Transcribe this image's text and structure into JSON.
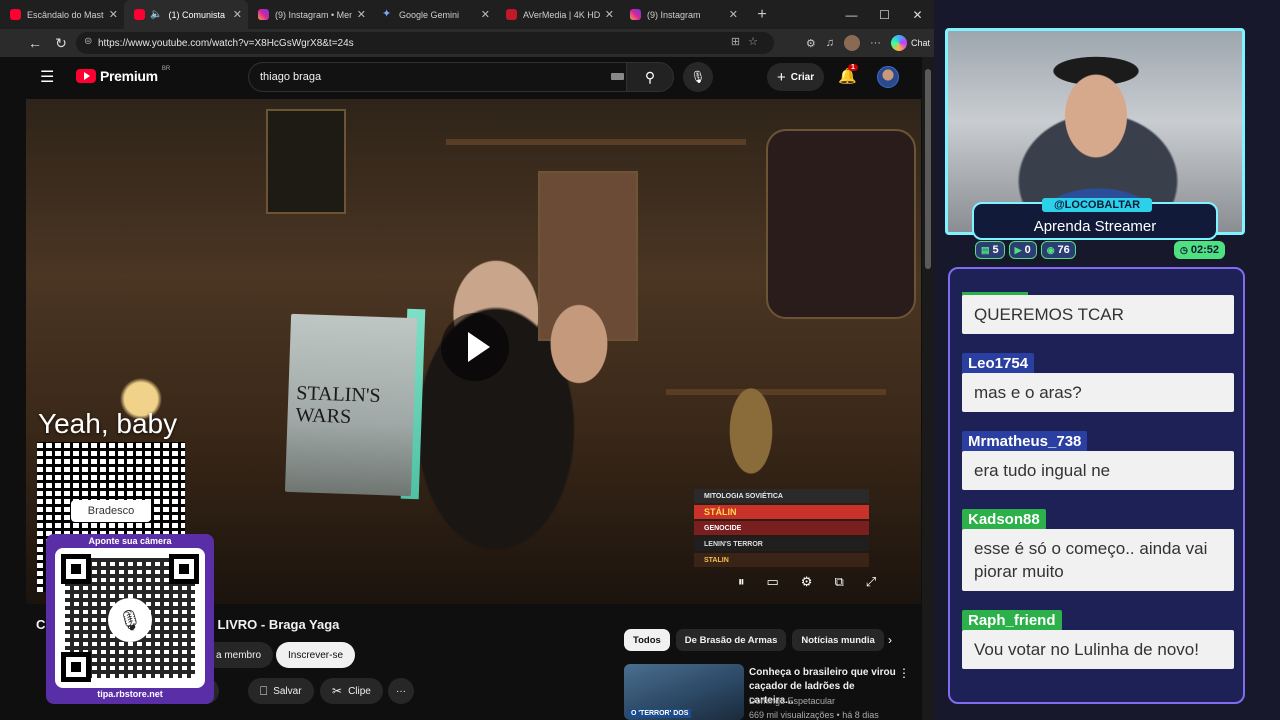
{
  "browser": {
    "tabs": [
      {
        "label": "Escândalo do Master s",
        "icon": "youtube-icon",
        "active": false
      },
      {
        "label": "(1) Comunista CH",
        "icon": "youtube-icon",
        "active": true
      },
      {
        "label": "(9) Instagram • Mensa",
        "icon": "instagram-icon",
        "active": false
      },
      {
        "label": "Google Gemini",
        "icon": "gemini-icon",
        "active": false
      },
      {
        "label": "AVerMedia | 4K HDMI",
        "icon": "avermedia-icon",
        "active": false
      },
      {
        "label": "(9) Instagram",
        "icon": "instagram-icon",
        "active": false
      }
    ],
    "url": "https://www.youtube.com/watch?v=X8HcGsWgrX8&t=24s",
    "chat_label": "Chat",
    "new_tab": "+"
  },
  "youtube": {
    "logo_text": "Premium",
    "country": "BR",
    "search_value": "thiago braga",
    "create_label": "Criar",
    "notification_count": "1",
    "video": {
      "title_start": "C",
      "title_end": "u LIVRO - Braga Yaga",
      "book_title": "STALIN'S WARS",
      "book_stack": [
        "MITOLOGIA SOVIÉTICA",
        "STÁLIN",
        "GENOCIDE",
        "LENIN'S TERROR",
        "STALIN"
      ],
      "join_label": "a membro",
      "subscribe_label": "Inscrever-se",
      "share_label": "ilhar",
      "save_label": "Salvar",
      "clip_label": "Clipe"
    },
    "chips": [
      {
        "label": "Todos",
        "active": true
      },
      {
        "label": "De Brasão de Armas",
        "active": false
      },
      {
        "label": "Notícias mundia",
        "active": false
      }
    ],
    "recommendation": {
      "title": "Conheça o brasileiro que virou caçador de ladrões de carteira...",
      "channel": "Domingo Espetacular",
      "meta": "669 mil visualizações • há 8 dias",
      "thumb_text": "O 'TERROR' DOS"
    }
  },
  "overlay": {
    "yeah_baby": "Yeah, baby",
    "bank_label": "Bradesco",
    "camera_title": "Aponte sua câmera",
    "camera_url": "tipa.rbstore.net"
  },
  "stream": {
    "handle": "@LOCOBALTAR",
    "tagline": "Aprenda Streamer",
    "stats": {
      "chat": "5",
      "videos": "0",
      "viewers": "76",
      "time": "02:52"
    },
    "chat": [
      {
        "user": "",
        "message": "QUEREMOS TCAR",
        "color": "green"
      },
      {
        "user": "Leo1754",
        "message": "mas e o aras?",
        "color": "blue"
      },
      {
        "user": "Mrmatheus_738",
        "message": "era tudo ingual ne",
        "color": "blue"
      },
      {
        "user": "Kadson88",
        "message": "esse é só o começo.. ainda vai piorar muito",
        "color": "green"
      },
      {
        "user": "Raph_friend",
        "message": "Vou votar no Lulinha de novo!",
        "color": "green"
      }
    ]
  }
}
